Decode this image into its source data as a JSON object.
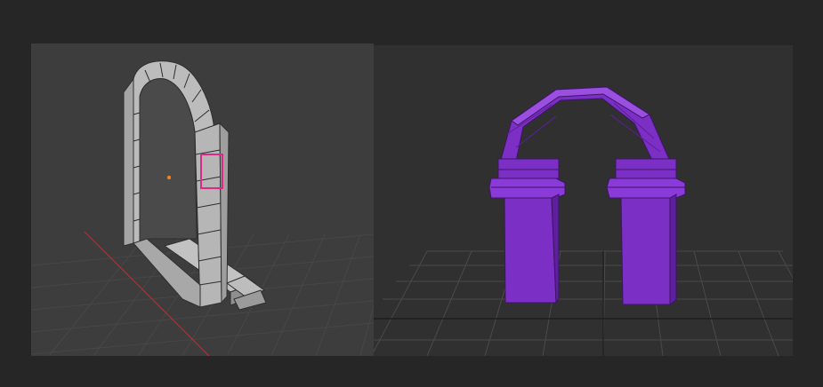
{
  "viewports": {
    "left": {
      "background": "#3d3d3d",
      "object": "stone-arch-mesh",
      "mesh_color": "#b4b4b4",
      "edge_color": "#2f2f2f",
      "selected_face_color": "#e0288a",
      "origin_color": "#f08020",
      "x_axis_color": "#a4343c"
    },
    "right": {
      "background": "#303030",
      "object": "arch-with-pillars",
      "mesh_color": "#7c2fc4",
      "dark_color": "#5e1f9c",
      "light_color": "#9a4fe0",
      "grid_color": "#4a4a4a"
    }
  }
}
